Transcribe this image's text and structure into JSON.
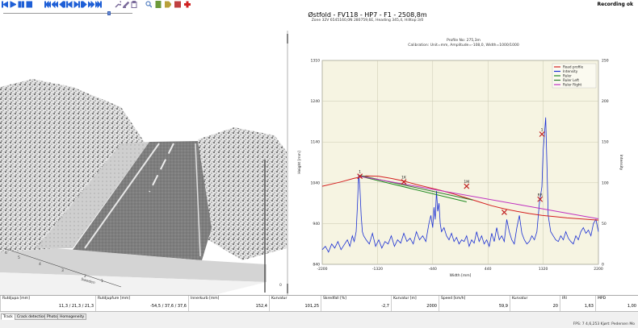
{
  "toolbar": {
    "status": "Recording ok",
    "playback_position": 0.83,
    "buttons": [
      {
        "id": "start",
        "icon": "skip-to-start-icon",
        "color": "#1e5fd6"
      },
      {
        "id": "play",
        "icon": "play-icon",
        "color": "#1e5fd6"
      },
      {
        "id": "pause",
        "icon": "pause-icon",
        "color": "#1e5fd6"
      },
      {
        "id": "stop",
        "icon": "stop-icon",
        "color": "#1e5fd6"
      },
      {
        "id": "first",
        "icon": "first-frame-icon",
        "color": "#1e5fd6"
      },
      {
        "id": "back-fast",
        "icon": "fast-rewind-icon",
        "color": "#1e5fd6"
      },
      {
        "id": "back",
        "icon": "rewind-icon",
        "color": "#1e5fd6"
      },
      {
        "id": "step-back",
        "icon": "step-back-icon",
        "color": "#1e5fd6"
      },
      {
        "id": "step-fwd",
        "icon": "step-forward-icon",
        "color": "#1e5fd6"
      },
      {
        "id": "fwd",
        "icon": "forward-icon",
        "color": "#1e5fd6"
      },
      {
        "id": "fwd-fast",
        "icon": "fast-forward-icon",
        "color": "#1e5fd6"
      },
      {
        "id": "last",
        "icon": "last-frame-icon",
        "color": "#1e5fd6"
      },
      {
        "id": "tools",
        "icon": "wrench-icon",
        "color": "#7a6a9a"
      },
      {
        "id": "edit",
        "icon": "edit-icon",
        "color": "#7a6a9a"
      },
      {
        "id": "clipboard",
        "icon": "clipboard-icon",
        "color": "#7a6a9a"
      },
      {
        "id": "zoom",
        "icon": "magnifier-icon",
        "color": "#5b84c4"
      },
      {
        "id": "notes",
        "icon": "notes-icon",
        "color": "#6c9a3a"
      },
      {
        "id": "tag",
        "icon": "tag-icon",
        "color": "#b8a03a"
      },
      {
        "id": "image",
        "icon": "image-icon",
        "color": "#c04040"
      },
      {
        "id": "add",
        "icon": "plus-icon",
        "color": "#d02020"
      }
    ]
  },
  "header": {
    "title": "Østfold - FV118 - HP7 - F1 - 2508,8m",
    "subtitle": "Zone 32V 6545160,0N 280759,6E, Heading 345,4, Hilltop:3/0"
  },
  "scene": {
    "axis_labels": [
      "6",
      "5",
      "4",
      "3",
      "2",
      "1",
      "Sweden"
    ],
    "right_tick": "0"
  },
  "chart_data": {
    "type": "line",
    "title": "Profile No: 275,3m",
    "subtitle": "Calibration: Unit=mm, Amplitude=-108,0, Width=1000/1000",
    "xlabel": "Width [mm]",
    "ylabel": "Height [mm]",
    "y2label": "Intensity",
    "xlim": [
      -2200,
      2200
    ],
    "ylim": [
      840,
      1310
    ],
    "y2lim": [
      0,
      250
    ],
    "xticks": [
      "-2200",
      "-1320",
      "-440",
      "440",
      "1320",
      "2200"
    ],
    "yticks": [
      "840",
      "940",
      "1040",
      "1140",
      "1240",
      "1310"
    ],
    "y2ticks": [
      "0",
      "50",
      "100",
      "150",
      "200",
      "250"
    ],
    "legend_position": "top-right",
    "legend": [
      "Road profile",
      "Intensity",
      "Ruler",
      "Ruler Left",
      "Ruler Right"
    ],
    "series": [
      {
        "name": "Road profile",
        "color": "#d42020",
        "x": [
          -2200,
          -1900,
          -1700,
          -1500,
          -1300,
          -1100,
          -900,
          -700,
          -500,
          -300,
          -100,
          100,
          300,
          500,
          700,
          900,
          1100,
          1300,
          1500,
          1700,
          1900,
          2100,
          2200
        ],
        "y": [
          1020,
          1030,
          1038,
          1044,
          1043,
          1038,
          1032,
          1024,
          1017,
          1010,
          1002,
          993,
          984,
          975,
          968,
          962,
          957,
          953,
          950,
          947,
          945,
          943,
          942
        ]
      },
      {
        "name": "Ruler",
        "color": "#1f8a1f",
        "x": [
          -1600,
          100
        ],
        "y": [
          1043,
          984
        ]
      },
      {
        "name": "Ruler Left",
        "color": "#2a7a2a",
        "x": [
          -1600,
          200
        ],
        "y": [
          1045,
          988
        ]
      },
      {
        "name": "Ruler Right",
        "color": "#c030c0",
        "x": [
          -1600,
          2200
        ],
        "y": [
          1043,
          945
        ]
      }
    ],
    "intensity": {
      "name": "Intensity",
      "color": "#1a2fd4",
      "x": [
        -2200,
        -2150,
        -2100,
        -2050,
        -2000,
        -1950,
        -1900,
        -1850,
        -1800,
        -1760,
        -1720,
        -1690,
        -1660,
        -1640,
        -1620,
        -1600,
        -1580,
        -1560,
        -1540,
        -1500,
        -1450,
        -1400,
        -1350,
        -1300,
        -1250,
        -1200,
        -1150,
        -1100,
        -1050,
        -1000,
        -950,
        -900,
        -850,
        -800,
        -750,
        -700,
        -650,
        -600,
        -550,
        -500,
        -470,
        -440,
        -420,
        -400,
        -380,
        -360,
        -340,
        -320,
        -300,
        -260,
        -220,
        -180,
        -140,
        -100,
        -60,
        -20,
        20,
        60,
        100,
        140,
        180,
        220,
        260,
        300,
        340,
        380,
        420,
        460,
        500,
        540,
        580,
        620,
        660,
        700,
        740,
        780,
        820,
        860,
        900,
        940,
        980,
        1020,
        1060,
        1100,
        1140,
        1180,
        1220,
        1260,
        1300,
        1320,
        1340,
        1360,
        1380,
        1400,
        1440,
        1480,
        1520,
        1560,
        1600,
        1640,
        1680,
        1720,
        1760,
        1800,
        1840,
        1880,
        1920,
        1960,
        2000,
        2040,
        2080,
        2120,
        2160,
        2200
      ],
      "y": [
        18,
        22,
        15,
        25,
        20,
        28,
        18,
        24,
        30,
        22,
        35,
        28,
        40,
        70,
        110,
        95,
        60,
        40,
        35,
        30,
        25,
        38,
        22,
        30,
        20,
        28,
        25,
        35,
        22,
        30,
        26,
        38,
        28,
        32,
        25,
        40,
        30,
        35,
        28,
        50,
        60,
        45,
        70,
        55,
        90,
        65,
        75,
        50,
        40,
        45,
        35,
        30,
        38,
        28,
        33,
        25,
        30,
        28,
        35,
        22,
        30,
        26,
        40,
        28,
        35,
        25,
        30,
        22,
        38,
        28,
        45,
        30,
        35,
        28,
        55,
        40,
        30,
        25,
        45,
        60,
        38,
        30,
        25,
        28,
        35,
        30,
        40,
        75,
        95,
        140,
        160,
        180,
        120,
        60,
        40,
        35,
        30,
        28,
        35,
        30,
        40,
        32,
        28,
        25,
        35,
        30,
        40,
        45,
        38,
        42,
        35,
        50,
        55,
        40,
        38
      ]
    },
    "markers": [
      {
        "x": -1600,
        "y": 1043,
        "label": "1"
      },
      {
        "x": -900,
        "y": 1030,
        "label": "1K"
      },
      {
        "x": 100,
        "y": 1020,
        "label": "1M"
      },
      {
        "x": 1270,
        "y": 990,
        "label": "RR"
      },
      {
        "x": 700,
        "y": 960,
        "label": ""
      },
      {
        "x": 1300,
        "y": 1140,
        "label": "1"
      }
    ]
  },
  "status_bar": [
    {
      "label": "Rutdjupa [mm]",
      "value": "11,3 / 21,3 / 21,3"
    },
    {
      "label": "Rutdjupfure [mm]",
      "value": "-54,5 / 37,6 / 37,6"
    },
    {
      "label": "Innerkurb [mm]",
      "value": "152,4"
    },
    {
      "label": "Kurvatur",
      "value": "101,25"
    },
    {
      "label": "Skredfall [%]",
      "value": "-2,7"
    },
    {
      "label": "Kurvatur [m]",
      "value": "2000"
    },
    {
      "label": "Speed [km/h]",
      "value": "59,9"
    },
    {
      "label": "Kurvatur",
      "value": "20"
    },
    {
      "label": "IRI",
      "value": "1,63"
    },
    {
      "label": "MPD",
      "value": "1,00"
    }
  ],
  "tabs": [
    "Track",
    "Crack detection",
    "Photo",
    "Homogeneity"
  ],
  "footer": "FPS: 7 4,6,253 Kjørt: Pedersen Mo"
}
